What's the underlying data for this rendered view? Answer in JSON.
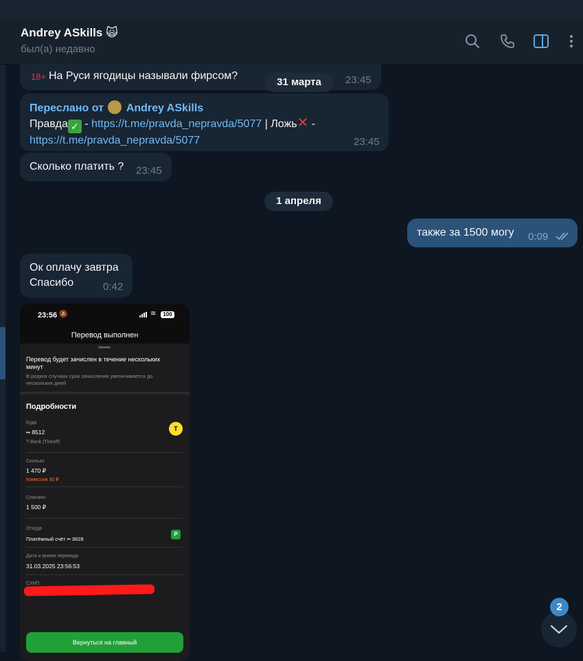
{
  "header": {
    "name": "Andrey ASkills",
    "name_emoji": "🙀",
    "status": "был(а) недавно",
    "icons": [
      "search-icon",
      "phone-icon",
      "sidebar-toggle-icon",
      "more-vertical-icon"
    ]
  },
  "messages": {
    "m1": {
      "age_badge": "18+",
      "text": "На Руси ягодицы называли фирсом?",
      "time": "23:45"
    },
    "date1": "31 марта",
    "m2": {
      "forward_label": "Переслано от",
      "forward_name": "Andrey ASkills",
      "t_true": "Правда",
      "sep1": " - ",
      "link1": "https://t.me/pravda_nepravda/5077",
      "t_false": " | Ложь",
      "sep2": " -",
      "link2": "https://t.me/pravda_nepravda/5077",
      "time": "23:45"
    },
    "m3": {
      "text": "Сколько платить ?",
      "time": "23:45"
    },
    "date2": "1 апреля",
    "m4": {
      "text": "также за 1500 могу",
      "time": "0:09"
    },
    "m5": {
      "line1": "Ок оплачу завтра",
      "line2": "Спасибо",
      "time": "0:42"
    }
  },
  "receipt": {
    "time": "23:56",
    "battery": "100",
    "title": "Перевод выполнен",
    "note": "Перевод будет зачислен в течение нескольких минут",
    "sub": "В редких случаях срок зачисления увеличивается до нескольких дней",
    "details_heading": "Подробности",
    "to_label": "Куда",
    "to_value": "•• 8512",
    "to_bank": "T-Bank (Tinkoff)",
    "amount_label": "Сколько",
    "amount_value": "1 470 ₽",
    "commission": "Комиссия 30 ₽",
    "debited_label": "Списано",
    "debited_value": "1 500 ₽",
    "from_label": "Откуда",
    "from_value": "Платёжный счёт •• 3628",
    "datetime_label": "Дата и время перевода",
    "datetime_value": "31.03.2025 23:56:53",
    "suip_label": "СУИП",
    "button": "Вернуться на главный",
    "t_logo": "T",
    "r_logo": "Р"
  },
  "scroll": {
    "unread": "2"
  },
  "colors": {
    "background": "#0e1621",
    "header": "#17212b",
    "incoming": "#182533",
    "outgoing": "#2b5278",
    "link": "#71baf5",
    "accent": "#3e88c8"
  }
}
